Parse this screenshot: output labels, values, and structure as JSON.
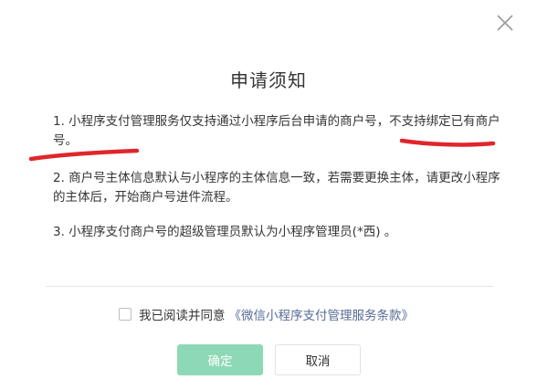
{
  "dialog": {
    "title": "申请须知",
    "notes": [
      "1. 小程序支付管理服务仅支持通过小程序后台申请的商户号，不支持绑定已有商户号。",
      "2. 商户号主体信息默认与小程序的主体信息一致，若需要更换主体，请更改小程序的主体后，开始商户号进件流程。",
      "3. 小程序支付商户号的超级管理员默认为小程序管理员(*西) 。"
    ],
    "agree_text": "我已阅读并同意",
    "agree_link": "《微信小程序支付管理服务条款》",
    "confirm_label": "确定",
    "cancel_label": "取消"
  },
  "colors": {
    "confirm_bg": "#8ed9b5",
    "link": "#576b95",
    "annotation": "#e0262b"
  },
  "icons": {
    "close": "close-icon"
  }
}
